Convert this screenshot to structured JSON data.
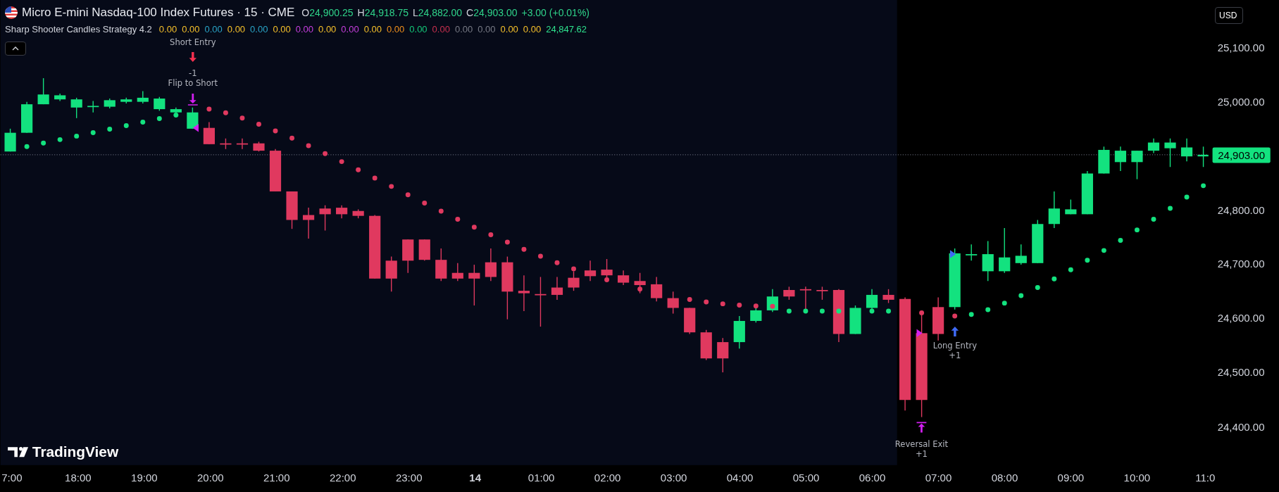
{
  "header": {
    "title": "Micro E-mini Nasdaq-100 Index Futures · 15 · CME",
    "ohlc": [
      {
        "label": "O",
        "value": "24,900.25"
      },
      {
        "label": "H",
        "value": "24,918.75"
      },
      {
        "label": "L",
        "value": "24,882.00"
      },
      {
        "label": "C",
        "value": "24,903.00"
      }
    ],
    "change": "+3.00 (+0.01%)"
  },
  "indicator": {
    "name": "Sharp Shooter Candles Strategy 4.2",
    "values": [
      {
        "text": "0.00",
        "color": "#f5c02a"
      },
      {
        "text": "0.00",
        "color": "#f5c02a"
      },
      {
        "text": "0.00",
        "color": "#2aa5c8"
      },
      {
        "text": "0.00",
        "color": "#f5c02a"
      },
      {
        "text": "0.00",
        "color": "#2aa5c8"
      },
      {
        "text": "0.00",
        "color": "#f5c02a"
      },
      {
        "text": "0.00",
        "color": "#c83fe0"
      },
      {
        "text": "0.00",
        "color": "#f5c02a"
      },
      {
        "text": "0.00",
        "color": "#c83fe0"
      },
      {
        "text": "0.00",
        "color": "#f5c02a"
      },
      {
        "text": "0.00",
        "color": "#f0901c"
      },
      {
        "text": "0.00",
        "color": "#14c97a"
      },
      {
        "text": "0.00",
        "color": "#c9304f"
      },
      {
        "text": "0.00",
        "color": "#787b86"
      },
      {
        "text": "0.00",
        "color": "#787b86"
      },
      {
        "text": "0.00",
        "color": "#f5c02a"
      },
      {
        "text": "0.00",
        "color": "#f5c02a"
      },
      {
        "text": "24,847.62",
        "color": "#2ee38e"
      }
    ]
  },
  "currency_button": "USD",
  "price_axis": [
    "25,100.00",
    "25,000.00",
    "24,800.00",
    "24,700.00",
    "24,600.00",
    "24,500.00",
    "24,400.00"
  ],
  "current_price": "24,903.00",
  "time_axis": [
    {
      "label": "7:00",
      "kind": "time"
    },
    {
      "label": "18:00",
      "kind": "time"
    },
    {
      "label": "19:00",
      "kind": "time"
    },
    {
      "label": "20:00",
      "kind": "time"
    },
    {
      "label": "21:00",
      "kind": "time"
    },
    {
      "label": "22:00",
      "kind": "time"
    },
    {
      "label": "23:00",
      "kind": "time"
    },
    {
      "label": "14",
      "kind": "date"
    },
    {
      "label": "01:00",
      "kind": "time"
    },
    {
      "label": "02:00",
      "kind": "time"
    },
    {
      "label": "03:00",
      "kind": "time"
    },
    {
      "label": "04:00",
      "kind": "time"
    },
    {
      "label": "05:00",
      "kind": "time"
    },
    {
      "label": "06:00",
      "kind": "time"
    },
    {
      "label": "07:00",
      "kind": "time"
    },
    {
      "label": "08:00",
      "kind": "time"
    },
    {
      "label": "09:00",
      "kind": "time"
    },
    {
      "label": "10:00",
      "kind": "time"
    },
    {
      "label": "11:0",
      "kind": "time"
    }
  ],
  "signals": [
    {
      "kind": "short_entry",
      "title": "Short Entry",
      "qty": "-1"
    },
    {
      "kind": "flip",
      "title": "Flip to Short"
    },
    {
      "kind": "long_entry",
      "title": "Long Entry",
      "qty": "+1"
    },
    {
      "kind": "reversal_exit",
      "title": "Reversal Exit",
      "qty": "+1"
    }
  ],
  "brand": "TradingView"
}
